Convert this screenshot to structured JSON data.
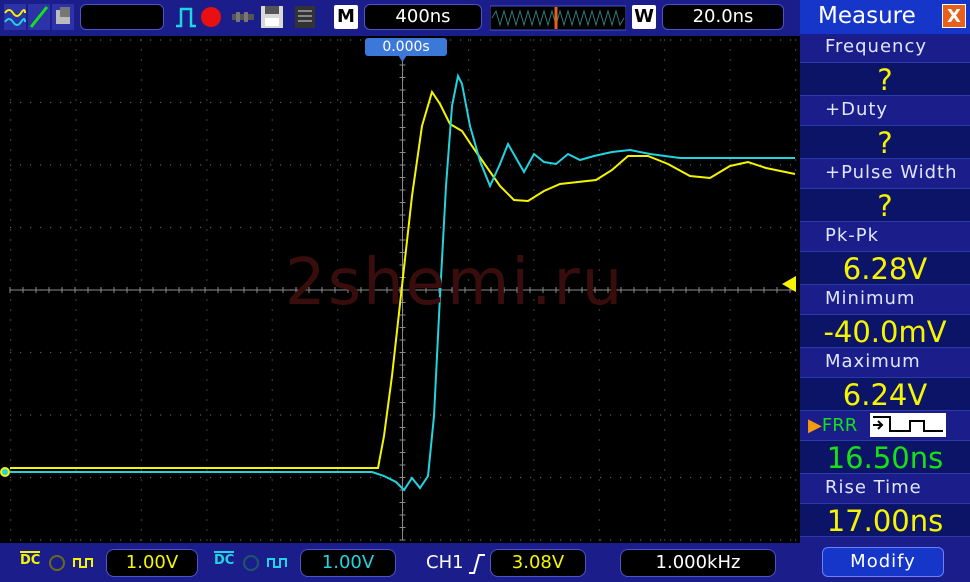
{
  "topbar": {
    "run_box": "",
    "menu_letter": "M",
    "timebase": "400ns",
    "window_letter": "W",
    "window_time": "20.0ns",
    "icons": [
      "waveform-icon",
      "measure-icon",
      "display-icon",
      "pulse-trigger-icon",
      "record-icon",
      "probe-icon",
      "save-icon",
      "list-icon"
    ]
  },
  "screen": {
    "trigger_time": "0.000s",
    "watermark": "2shemi.ru",
    "colors": {
      "ch1": "#f5f500",
      "ch2": "#22d3e0",
      "grid": "#5a5a5a",
      "trigger": "#f5f500"
    }
  },
  "bottombar": {
    "ch1_coupling": "DC",
    "ch1_scale": "1.00V",
    "ch2_coupling": "DC",
    "ch2_scale": "1.00V",
    "trigger_source": "CH1",
    "trigger_level": "3.08V",
    "frequency": "1.000kHz"
  },
  "panel": {
    "title": "Measure",
    "close": "X",
    "items": [
      {
        "label": "Frequency",
        "value": "?"
      },
      {
        "label": "+Duty",
        "value": "?"
      },
      {
        "label": "+Pulse Width",
        "value": "?"
      },
      {
        "label": "Pk-Pk",
        "value": "6.28V"
      },
      {
        "label": "Minimum",
        "value": "-40.0mV"
      },
      {
        "label": "Maximum",
        "value": "6.24V"
      }
    ],
    "frr_label": "FRR",
    "frr_value": "16.50ns",
    "rise_label": "Rise Time",
    "rise_value": "17.00ns",
    "modify": "Modify"
  }
}
